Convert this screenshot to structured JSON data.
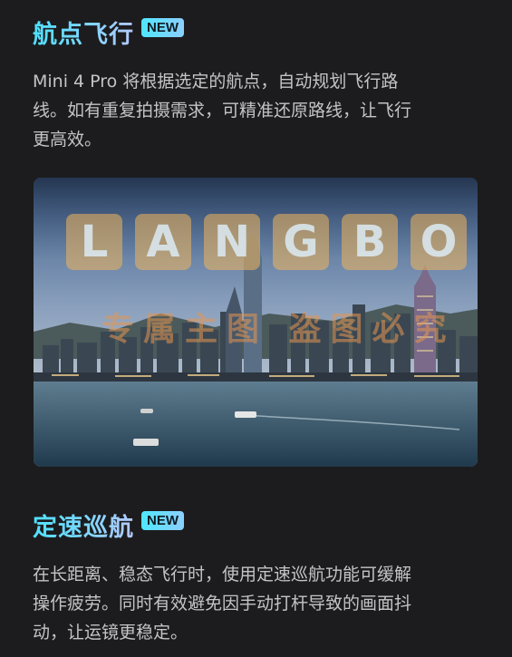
{
  "sections": [
    {
      "title": "航点飞行",
      "badge": "NEW",
      "lines": [
        "Mini 4 Pro 将根据选定的航点，自动规划飞行路",
        "线。如有重复拍摄需求，可精准还原路线，让飞行",
        "更高效。"
      ]
    },
    {
      "title": "定速巡航",
      "badge": "NEW",
      "lines": [
        "在长距离、稳态飞行时，使用定速巡航功能可缓解",
        "操作疲劳。同时有效避免因手动打杆导致的画面抖",
        "动，让运镜更稳定。"
      ]
    }
  ],
  "image": {
    "subject": "Hong Kong harbour skyline at dusk",
    "watermark_letters": [
      "L",
      "A",
      "N",
      "G",
      "B",
      "O"
    ],
    "watermark_text": "专属主图 盗图必究"
  },
  "colors": {
    "background": "#1c1c1e",
    "title_gradient_start": "#4fe0ff",
    "title_gradient_end": "#b6c8ff",
    "body_text": "#c4c4c7"
  }
}
